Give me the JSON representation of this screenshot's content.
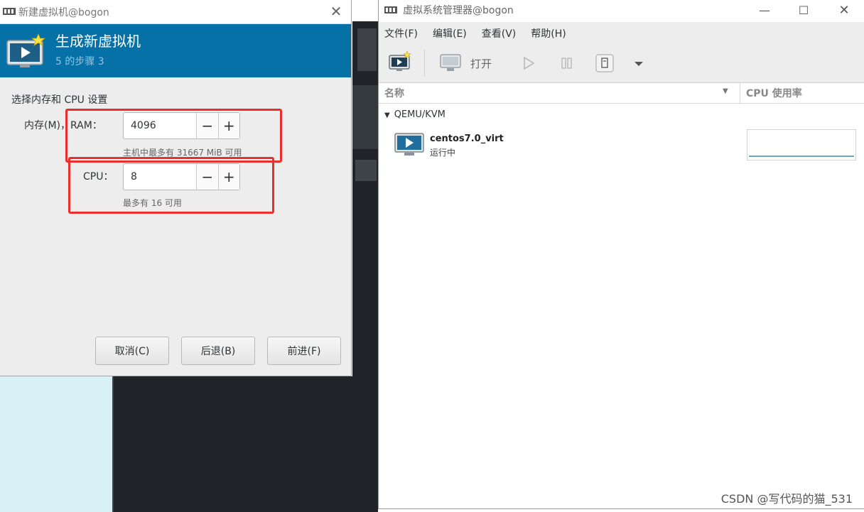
{
  "wizard": {
    "title": "新建虚拟机@bogon",
    "heading": "生成新虚拟机",
    "step": "5 的步骤 3",
    "section_title": "选择内存和 CPU 设置",
    "memory": {
      "label": "内存(M)，RAM：",
      "value": "4096",
      "hint": "主机中最多有 31667 MiB 可用"
    },
    "cpu": {
      "label": "CPU：",
      "value": "8",
      "hint": "最多有 16 可用"
    },
    "minus_symbol": "−",
    "plus_symbol": "+",
    "buttons": {
      "cancel": "取消(C)",
      "back": "后退(B)",
      "forward": "前进(F)"
    },
    "close_symbol": "✕"
  },
  "manager": {
    "title": "虚拟系统管理器@bogon",
    "window_controls": {
      "minimize": "—",
      "maximize": "☐",
      "close": "✕"
    },
    "menu": [
      "文件(F)",
      "编辑(E)",
      "查看(V)",
      "帮助(H)"
    ],
    "toolbar": {
      "open_label": "打开"
    },
    "columns": {
      "name": "名称",
      "cpu": "CPU 使用率"
    },
    "group": "QEMU/KVM",
    "vms": [
      {
        "name": "centos7.0_virt",
        "status": "运行中"
      }
    ]
  },
  "watermark": "CSDN @写代码的猫_531",
  "colors": {
    "banner": "#0571a7",
    "highlight": "#e8312f"
  }
}
